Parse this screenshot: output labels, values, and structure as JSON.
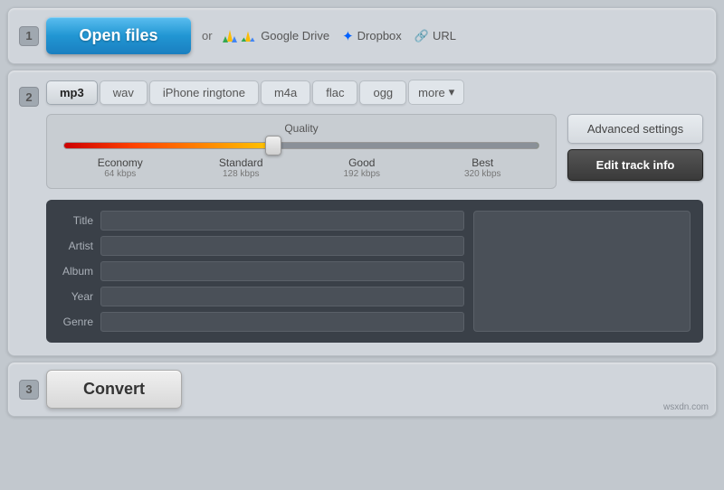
{
  "steps": {
    "step1": "1",
    "step2": "2",
    "step3": "3"
  },
  "section1": {
    "open_files_label": "Open files",
    "or_text": "or",
    "google_drive_label": "Google Drive",
    "dropbox_label": "Dropbox",
    "url_label": "URL"
  },
  "section2": {
    "tabs": [
      {
        "id": "mp3",
        "label": "mp3",
        "active": true
      },
      {
        "id": "wav",
        "label": "wav",
        "active": false
      },
      {
        "id": "iphone",
        "label": "iPhone ringtone",
        "active": false
      },
      {
        "id": "m4a",
        "label": "m4a",
        "active": false
      },
      {
        "id": "flac",
        "label": "flac",
        "active": false
      },
      {
        "id": "ogg",
        "label": "ogg",
        "active": false
      },
      {
        "id": "more",
        "label": "more",
        "active": false
      }
    ],
    "quality_label": "Quality",
    "slider_labels": [
      {
        "label": "Economy",
        "kbps": "64 kbps"
      },
      {
        "label": "Standard",
        "kbps": "128 kbps"
      },
      {
        "label": "Good",
        "kbps": "192 kbps"
      },
      {
        "label": "Best",
        "kbps": "320 kbps"
      }
    ],
    "advanced_settings_label": "Advanced settings",
    "edit_track_label": "Edit track info",
    "track_fields": [
      {
        "label": "Title",
        "value": ""
      },
      {
        "label": "Artist",
        "value": ""
      },
      {
        "label": "Album",
        "value": ""
      },
      {
        "label": "Year",
        "value": ""
      },
      {
        "label": "Genre",
        "value": ""
      }
    ]
  },
  "section3": {
    "convert_label": "Convert"
  },
  "watermark": "wsxdn.com"
}
